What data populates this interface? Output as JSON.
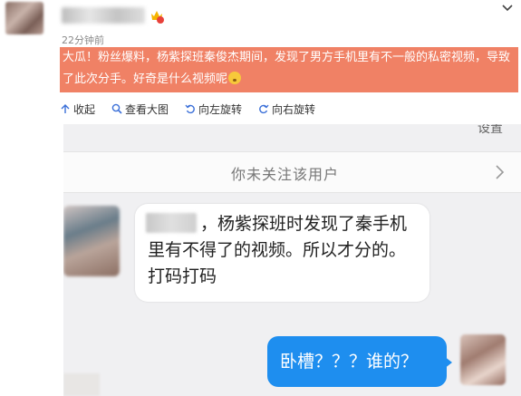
{
  "post": {
    "time": "22分钟前",
    "text": "大瓜！粉丝爆料，杨紫探班秦俊杰期间，发现了男方手机里有不一般的私密视频，导致了此次分手。好奇是什么视频呢"
  },
  "toolbar": {
    "collapse": "收起",
    "view_large": "查看大图",
    "rotate_left": "向左旋转",
    "rotate_right": "向右旋转"
  },
  "screenshot": {
    "follow_text": "你未关注该用户",
    "top_fragment": "设置",
    "message_left": "，杨紫探班时发现了秦手机里有不得了的视频。所以才分的。打码打码",
    "message_right": "卧槽？？？谁的？"
  },
  "colors": {
    "highlight": "#f08165",
    "bubble_blue": "#1e8eef",
    "chat_bg": "#f0f0f2"
  }
}
